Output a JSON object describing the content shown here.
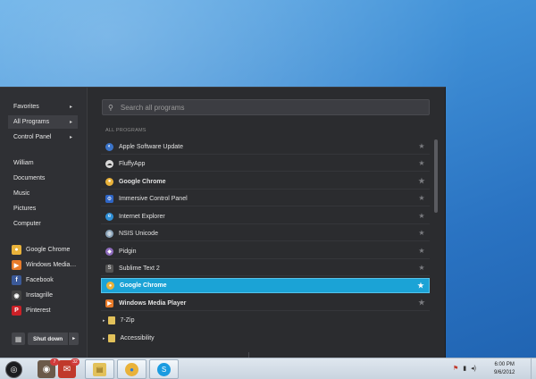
{
  "left_nav": [
    {
      "label": "Favorites",
      "arrow": "▸"
    },
    {
      "label": "All Programs",
      "arrow": "▸"
    },
    {
      "label": "Control Panel",
      "arrow": "▸"
    }
  ],
  "places": [
    "William",
    "Documents",
    "Music",
    "Pictures",
    "Computer"
  ],
  "pinned": [
    {
      "label": "Google Chrome",
      "icon": "chrome-icon",
      "color": "#e9b23a",
      "glyph": "●"
    },
    {
      "label": "Windows Media…",
      "icon": "media-player-icon",
      "color": "#e87b2a",
      "glyph": "▶"
    },
    {
      "label": "Facebook",
      "icon": "facebook-icon",
      "color": "#3b5998",
      "glyph": "f"
    },
    {
      "label": "Instagrille",
      "icon": "instagram-icon",
      "color": "#444444",
      "glyph": "◉"
    },
    {
      "label": "Pinterest",
      "icon": "pinterest-icon",
      "color": "#cb2027",
      "glyph": "P"
    }
  ],
  "shutdown": {
    "label": "Shut down",
    "arrow": "▸"
  },
  "search": {
    "placeholder": "Search all programs"
  },
  "section_label": "ALL PROGRAMS",
  "programs": [
    {
      "label": "Apple Software Update",
      "icon": "apple-update-icon",
      "color": "#3b74c9",
      "glyph": "◐"
    },
    {
      "label": "FluffyApp",
      "icon": "cloud-icon",
      "color": "#d9d9d9",
      "glyph": "☁"
    },
    {
      "label": "Google Chrome",
      "icon": "chrome-icon",
      "color": "#e9b23a",
      "glyph": "●"
    },
    {
      "label": "Immersive Control Panel",
      "icon": "gear-icon",
      "color": "#2f66c6",
      "glyph": "⚙"
    },
    {
      "label": "Internet Explorer",
      "icon": "ie-icon",
      "color": "#2e8fd6",
      "glyph": "e"
    },
    {
      "label": "NSIS Unicode",
      "icon": "nsis-icon",
      "color": "#8aa3b8",
      "glyph": "◍"
    },
    {
      "label": "Pidgin",
      "icon": "pidgin-icon",
      "color": "#8e6bbd",
      "glyph": "◆"
    },
    {
      "label": "Sublime Text 2",
      "icon": "sublime-icon",
      "color": "#555555",
      "glyph": "S"
    },
    {
      "label": "Google Chrome",
      "icon": "chrome-icon",
      "color": "#e9b23a",
      "glyph": "●",
      "selected": true
    },
    {
      "label": "Windows Media Player",
      "icon": "media-player-icon",
      "color": "#e87b2a",
      "glyph": "▶"
    }
  ],
  "folders": [
    {
      "label": "7-Zip",
      "arrow": "▸"
    },
    {
      "label": "Accessibility",
      "arrow": "▸"
    }
  ],
  "star_glyph": "★",
  "taskbar": {
    "start_glyph": "◎",
    "pinned": [
      {
        "icon": "instagram-icon",
        "color": "#6b5a4a",
        "glyph": "◉",
        "badge": "7"
      },
      {
        "icon": "mail-icon",
        "color": "#c0392b",
        "glyph": "✉",
        "badge": "32"
      }
    ],
    "tasks": [
      {
        "icon": "folder-icon",
        "color": "#e2c15a",
        "glyph": "▤"
      },
      {
        "icon": "chrome-icon",
        "color": "#e9b23a",
        "glyph": "●"
      },
      {
        "icon": "skype-icon",
        "color": "#1a9be0",
        "glyph": "S"
      }
    ],
    "tray": [
      "⚑",
      "▮",
      "◂)"
    ],
    "time": "6:00 PM",
    "date": "9/6/2012"
  }
}
